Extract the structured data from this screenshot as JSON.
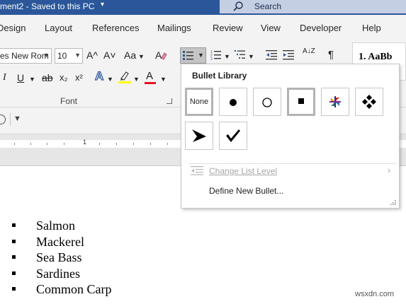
{
  "titlebar": {
    "doc_title": "ment2  -  Saved to this PC",
    "search_placeholder": "Search"
  },
  "tabs": [
    "Design",
    "Layout",
    "References",
    "Mailings",
    "Review",
    "View",
    "Developer",
    "Help"
  ],
  "ribbon": {
    "font_name": "es New Rom",
    "font_size": "10",
    "grow_font": "A^",
    "shrink_font": "A˅",
    "change_case": "Aa",
    "italic": "I",
    "underline": "U",
    "strikethrough": "ab",
    "subscript": "x₂",
    "superscript": "x²",
    "text_effects": "A",
    "font_color": "A",
    "sort": "A↓Z",
    "pilcrow": "¶",
    "font_group_label": "Font",
    "styles_preview": "1. AaBb"
  },
  "ruler": {
    "number": "1"
  },
  "bullet_menu": {
    "heading": "Bullet Library",
    "none_label": "None",
    "change_list_level": "Change List Level",
    "define_new_bullet": "Define New Bullet..."
  },
  "document": {
    "items": [
      "Salmon",
      "Mackerel",
      "Sea Bass",
      "Sardines",
      "Common Carp"
    ]
  },
  "watermark": "wsxdn.com",
  "colors": {
    "title_bar": "#2b579a",
    "ribbon_bg": "#f3f3f3",
    "highlight_yellow": "#ffff00",
    "font_red": "#e81123"
  }
}
